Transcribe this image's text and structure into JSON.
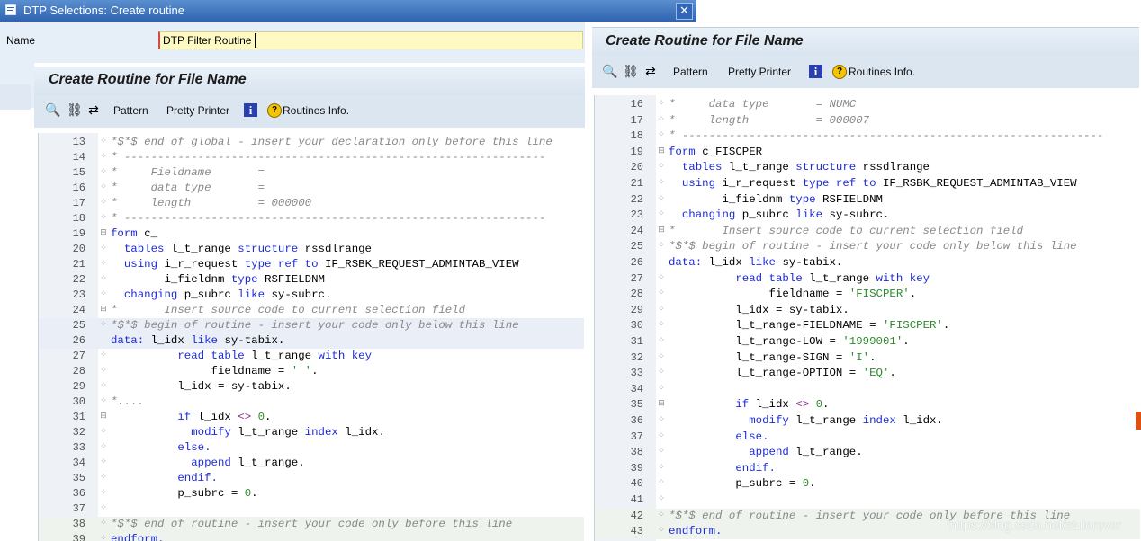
{
  "dialog": {
    "title": "DTP Selections: Create routine",
    "close_glyph": "✕",
    "name_label": "Name",
    "name_value": "DTP Filter Routine"
  },
  "panel": {
    "title": "Create Routine for File Name",
    "toolbar": {
      "pattern": "Pattern",
      "pretty_printer": "Pretty Printer",
      "info_glyph": "i",
      "routines_info": "Routines Info."
    }
  },
  "left_code": [
    {
      "n": "13",
      "fold": "x",
      "tokens": [
        {
          "c": "cmt",
          "t": "*$*$ end of global - insert your declaration only before this line"
        }
      ]
    },
    {
      "n": "14",
      "fold": "x",
      "tokens": [
        {
          "c": "cmt",
          "t": "* ---------------------------------------------------------------"
        }
      ]
    },
    {
      "n": "15",
      "fold": "x",
      "tokens": [
        {
          "c": "cmt",
          "t": "*     Fieldname       ="
        }
      ]
    },
    {
      "n": "16",
      "fold": "x",
      "tokens": [
        {
          "c": "cmt",
          "t": "*     data type       ="
        }
      ]
    },
    {
      "n": "17",
      "fold": "x",
      "tokens": [
        {
          "c": "cmt",
          "t": "*     length          = 000000"
        }
      ]
    },
    {
      "n": "18",
      "fold": "x",
      "tokens": [
        {
          "c": "cmt",
          "t": "* ---------------------------------------------------------------"
        }
      ]
    },
    {
      "n": "19",
      "fold": "box",
      "tokens": [
        {
          "c": "kw",
          "t": "form "
        },
        {
          "c": "plain",
          "t": "c_"
        }
      ]
    },
    {
      "n": "20",
      "fold": "x",
      "tokens": [
        {
          "c": "kw",
          "t": "  tables "
        },
        {
          "c": "plain",
          "t": "l_t_range "
        },
        {
          "c": "kw",
          "t": "structure "
        },
        {
          "c": "plain",
          "t": "rssdlrange"
        }
      ]
    },
    {
      "n": "21",
      "fold": "x",
      "tokens": [
        {
          "c": "kw",
          "t": "  using "
        },
        {
          "c": "plain",
          "t": "i_r_request "
        },
        {
          "c": "kw",
          "t": "type ref to "
        },
        {
          "c": "plain",
          "t": "IF_RSBK_REQUEST_ADMINTAB_VIEW"
        }
      ]
    },
    {
      "n": "22",
      "fold": "x",
      "tokens": [
        {
          "c": "plain",
          "t": "        i_fieldnm "
        },
        {
          "c": "kw",
          "t": "type "
        },
        {
          "c": "plain",
          "t": "RSFIELDNM"
        }
      ]
    },
    {
      "n": "23",
      "fold": "x",
      "tokens": [
        {
          "c": "kw",
          "t": "  changing "
        },
        {
          "c": "plain",
          "t": "p_subrc "
        },
        {
          "c": "kw",
          "t": "like "
        },
        {
          "c": "plain",
          "t": "sy-subrc."
        }
      ]
    },
    {
      "n": "24",
      "fold": "box",
      "tokens": [
        {
          "c": "cmt",
          "t": "*       Insert source code to current selection field"
        }
      ]
    },
    {
      "n": "25",
      "fold": "x",
      "tokens": [
        {
          "c": "cmt",
          "t": "*$*$ begin of routine - insert your code only below this line"
        }
      ],
      "hl": true
    },
    {
      "n": "26",
      "fold": "",
      "tokens": [
        {
          "c": "kw",
          "t": "data: "
        },
        {
          "c": "plain",
          "t": "l_idx "
        },
        {
          "c": "kw",
          "t": "like "
        },
        {
          "c": "plain",
          "t": "sy-tabix."
        }
      ],
      "hl": true
    },
    {
      "n": "27",
      "fold": "x",
      "tokens": [
        {
          "c": "kw",
          "t": "          read table "
        },
        {
          "c": "plain",
          "t": "l_t_range "
        },
        {
          "c": "kw",
          "t": "with key"
        }
      ]
    },
    {
      "n": "28",
      "fold": "x",
      "tokens": [
        {
          "c": "plain",
          "t": "               fieldname = "
        },
        {
          "c": "str",
          "t": "' '"
        },
        {
          "c": "plain",
          "t": "."
        }
      ]
    },
    {
      "n": "29",
      "fold": "x",
      "tokens": [
        {
          "c": "plain",
          "t": "          l_idx = sy-tabix."
        }
      ]
    },
    {
      "n": "30",
      "fold": "x",
      "tokens": [
        {
          "c": "cmt",
          "t": "*...."
        }
      ]
    },
    {
      "n": "31",
      "fold": "box",
      "tokens": [
        {
          "c": "kw",
          "t": "          if "
        },
        {
          "c": "plain",
          "t": "l_idx "
        },
        {
          "c": "op",
          "t": "<> "
        },
        {
          "c": "num",
          "t": "0"
        },
        {
          "c": "plain",
          "t": "."
        }
      ]
    },
    {
      "n": "32",
      "fold": "x",
      "tokens": [
        {
          "c": "kw",
          "t": "            modify "
        },
        {
          "c": "plain",
          "t": "l_t_range "
        },
        {
          "c": "kw",
          "t": "index "
        },
        {
          "c": "plain",
          "t": "l_idx."
        }
      ]
    },
    {
      "n": "33",
      "fold": "x",
      "tokens": [
        {
          "c": "kw",
          "t": "          else."
        }
      ]
    },
    {
      "n": "34",
      "fold": "x",
      "tokens": [
        {
          "c": "kw",
          "t": "            append "
        },
        {
          "c": "plain",
          "t": "l_t_range."
        }
      ]
    },
    {
      "n": "35",
      "fold": "x",
      "tokens": [
        {
          "c": "kw",
          "t": "          endif."
        }
      ]
    },
    {
      "n": "36",
      "fold": "x",
      "tokens": [
        {
          "c": "plain",
          "t": "          p_subrc = "
        },
        {
          "c": "num",
          "t": "0"
        },
        {
          "c": "plain",
          "t": "."
        }
      ]
    },
    {
      "n": "37",
      "fold": "x",
      "tokens": []
    },
    {
      "n": "38",
      "fold": "x",
      "tokens": [
        {
          "c": "cmt",
          "t": "*$*$ end of routine - insert your code only before this line"
        }
      ],
      "hl2": true
    },
    {
      "n": "39",
      "fold": "x",
      "tokens": [
        {
          "c": "kw",
          "t": "endform."
        }
      ],
      "hl2": true
    }
  ],
  "right_code": [
    {
      "n": "16",
      "fold": "x",
      "tokens": [
        {
          "c": "cmt",
          "t": "*     data type       = NUMC"
        }
      ]
    },
    {
      "n": "17",
      "fold": "x",
      "tokens": [
        {
          "c": "cmt",
          "t": "*     length          = 000007"
        }
      ]
    },
    {
      "n": "18",
      "fold": "x",
      "tokens": [
        {
          "c": "cmt",
          "t": "* ---------------------------------------------------------------"
        }
      ]
    },
    {
      "n": "19",
      "fold": "box",
      "tokens": [
        {
          "c": "kw",
          "t": "form "
        },
        {
          "c": "plain",
          "t": "c_FISCPER"
        }
      ]
    },
    {
      "n": "20",
      "fold": "x",
      "tokens": [
        {
          "c": "kw",
          "t": "  tables "
        },
        {
          "c": "plain",
          "t": "l_t_range "
        },
        {
          "c": "kw",
          "t": "structure "
        },
        {
          "c": "plain",
          "t": "rssdlrange"
        }
      ]
    },
    {
      "n": "21",
      "fold": "x",
      "tokens": [
        {
          "c": "kw",
          "t": "  using "
        },
        {
          "c": "plain",
          "t": "i_r_request "
        },
        {
          "c": "kw",
          "t": "type ref to "
        },
        {
          "c": "plain",
          "t": "IF_RSBK_REQUEST_ADMINTAB_VIEW"
        }
      ]
    },
    {
      "n": "22",
      "fold": "x",
      "tokens": [
        {
          "c": "plain",
          "t": "        i_fieldnm "
        },
        {
          "c": "kw",
          "t": "type "
        },
        {
          "c": "plain",
          "t": "RSFIELDNM"
        }
      ]
    },
    {
      "n": "23",
      "fold": "x",
      "tokens": [
        {
          "c": "kw",
          "t": "  changing "
        },
        {
          "c": "plain",
          "t": "p_subrc "
        },
        {
          "c": "kw",
          "t": "like "
        },
        {
          "c": "plain",
          "t": "sy-subrc."
        }
      ]
    },
    {
      "n": "24",
      "fold": "box",
      "tokens": [
        {
          "c": "cmt",
          "t": "*       Insert source code to current selection field"
        }
      ]
    },
    {
      "n": "25",
      "fold": "x",
      "tokens": [
        {
          "c": "cmt",
          "t": "*$*$ begin of routine - insert your code only below this line"
        }
      ]
    },
    {
      "n": "26",
      "fold": "",
      "tokens": [
        {
          "c": "kw",
          "t": "data: "
        },
        {
          "c": "plain",
          "t": "l_idx "
        },
        {
          "c": "kw",
          "t": "like "
        },
        {
          "c": "plain",
          "t": "sy-tabix."
        }
      ]
    },
    {
      "n": "27",
      "fold": "x",
      "tokens": [
        {
          "c": "kw",
          "t": "          read table "
        },
        {
          "c": "plain",
          "t": "l_t_range "
        },
        {
          "c": "kw",
          "t": "with key"
        }
      ]
    },
    {
      "n": "28",
      "fold": "x",
      "tokens": [
        {
          "c": "plain",
          "t": "               fieldname = "
        },
        {
          "c": "str",
          "t": "'FISCPER'"
        },
        {
          "c": "plain",
          "t": "."
        }
      ]
    },
    {
      "n": "29",
      "fold": "x",
      "tokens": [
        {
          "c": "plain",
          "t": "          l_idx = sy-tabix."
        }
      ]
    },
    {
      "n": "30",
      "fold": "x",
      "tokens": [
        {
          "c": "plain",
          "t": "          l_t_range-FIELDNAME = "
        },
        {
          "c": "str",
          "t": "'FISCPER'"
        },
        {
          "c": "plain",
          "t": "."
        }
      ]
    },
    {
      "n": "31",
      "fold": "x",
      "tokens": [
        {
          "c": "plain",
          "t": "          l_t_range-LOW = "
        },
        {
          "c": "str",
          "t": "'1999001'"
        },
        {
          "c": "plain",
          "t": "."
        }
      ]
    },
    {
      "n": "32",
      "fold": "x",
      "tokens": [
        {
          "c": "plain",
          "t": "          l_t_range-SIGN = "
        },
        {
          "c": "str",
          "t": "'I'"
        },
        {
          "c": "plain",
          "t": "."
        }
      ]
    },
    {
      "n": "33",
      "fold": "x",
      "tokens": [
        {
          "c": "plain",
          "t": "          l_t_range-OPTION = "
        },
        {
          "c": "str",
          "t": "'EQ'"
        },
        {
          "c": "plain",
          "t": "."
        }
      ]
    },
    {
      "n": "34",
      "fold": "x",
      "tokens": []
    },
    {
      "n": "35",
      "fold": "box",
      "tokens": [
        {
          "c": "kw",
          "t": "          if "
        },
        {
          "c": "plain",
          "t": "l_idx "
        },
        {
          "c": "op",
          "t": "<> "
        },
        {
          "c": "num",
          "t": "0"
        },
        {
          "c": "plain",
          "t": "."
        }
      ]
    },
    {
      "n": "36",
      "fold": "x",
      "tokens": [
        {
          "c": "kw",
          "t": "            modify "
        },
        {
          "c": "plain",
          "t": "l_t_range "
        },
        {
          "c": "kw",
          "t": "index "
        },
        {
          "c": "plain",
          "t": "l_idx."
        }
      ]
    },
    {
      "n": "37",
      "fold": "x",
      "tokens": [
        {
          "c": "kw",
          "t": "          else."
        }
      ]
    },
    {
      "n": "38",
      "fold": "x",
      "tokens": [
        {
          "c": "kw",
          "t": "            append "
        },
        {
          "c": "plain",
          "t": "l_t_range."
        }
      ]
    },
    {
      "n": "39",
      "fold": "x",
      "tokens": [
        {
          "c": "kw",
          "t": "          endif."
        }
      ]
    },
    {
      "n": "40",
      "fold": "x",
      "tokens": [
        {
          "c": "plain",
          "t": "          p_subrc = "
        },
        {
          "c": "num",
          "t": "0"
        },
        {
          "c": "plain",
          "t": "."
        }
      ]
    },
    {
      "n": "41",
      "fold": "x",
      "tokens": []
    },
    {
      "n": "42",
      "fold": "x",
      "tokens": [
        {
          "c": "cmt",
          "t": "*$*$ end of routine - insert your code only before this line"
        }
      ],
      "hl2": true
    },
    {
      "n": "43",
      "fold": "x",
      "tokens": [
        {
          "c": "kw",
          "t": "endform."
        }
      ],
      "hl2": true
    }
  ],
  "watermark": "https://blog.csdn.net/stulorever",
  "colors": {
    "keyword": "#1c2bd8",
    "comment": "#888888",
    "string": "#2b8a2b",
    "titlebar": "#2f63b0"
  }
}
